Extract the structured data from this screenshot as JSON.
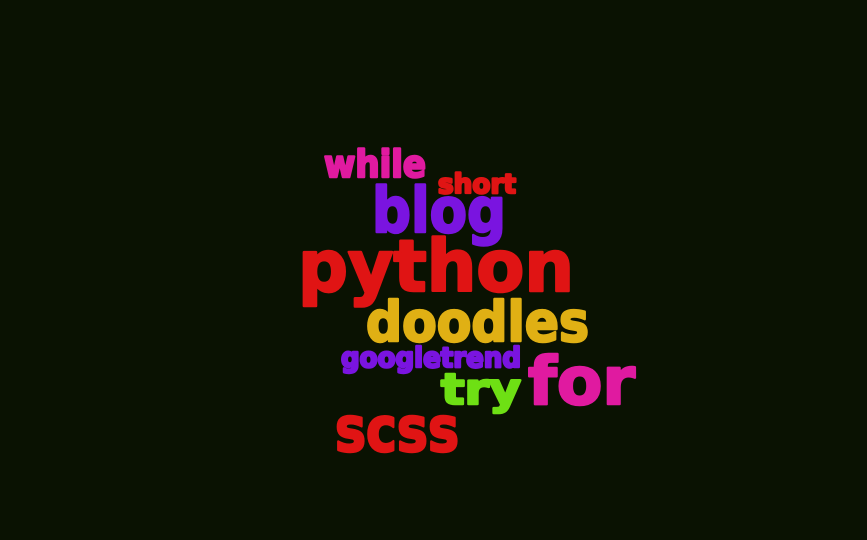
{
  "background_color": "#0a1202",
  "words": [
    {
      "text": "while",
      "color": "#e01aa0"
    },
    {
      "text": "short",
      "color": "#e01414"
    },
    {
      "text": "blog",
      "color": "#7a14e0"
    },
    {
      "text": "python",
      "color": "#e01414"
    },
    {
      "text": "doodles",
      "color": "#e0b014"
    },
    {
      "text": "googletrend",
      "color": "#7a14e0"
    },
    {
      "text": "try",
      "color": "#6ee014"
    },
    {
      "text": "for",
      "color": "#e01aa0"
    },
    {
      "text": "scss",
      "color": "#e01414"
    }
  ]
}
